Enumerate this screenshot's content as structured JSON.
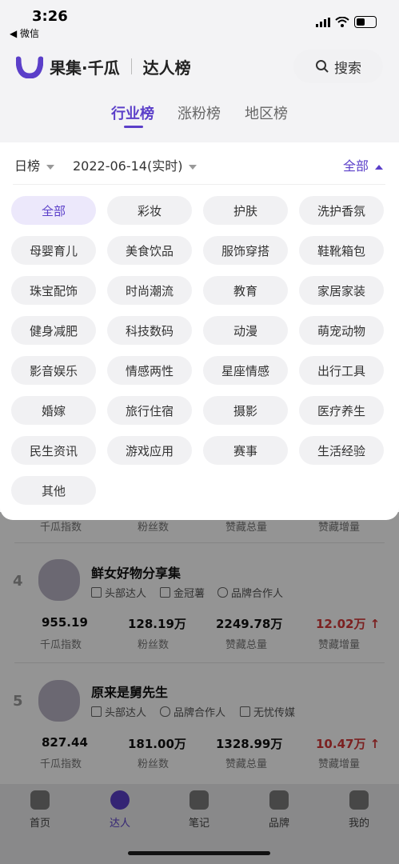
{
  "status_bar": {
    "time": "3:26",
    "back_app": "◀ 微信"
  },
  "header": {
    "brand": "果集·千瓜",
    "title": "达人榜",
    "search_label": "搜索"
  },
  "tabs": [
    {
      "label": "行业榜",
      "active": true
    },
    {
      "label": "涨粉榜",
      "active": false
    },
    {
      "label": "地区榜",
      "active": false
    }
  ],
  "filters": {
    "period": "日榜",
    "date": "2022-06-14(实时)",
    "toggle": "全部"
  },
  "categories": [
    "全部",
    "彩妆",
    "护肤",
    "洗护香氛",
    "母婴育儿",
    "美食饮品",
    "服饰穿搭",
    "鞋靴箱包",
    "珠宝配饰",
    "时尚潮流",
    "教育",
    "家居家装",
    "健身减肥",
    "科技数码",
    "动漫",
    "萌宠动物",
    "影音娱乐",
    "情感两性",
    "星座情感",
    "出行工具",
    "婚嫁",
    "旅行住宿",
    "摄影",
    "医疗养生",
    "民生资讯",
    "游戏应用",
    "赛事",
    "生活经验",
    "其他"
  ],
  "prev_row_labels": [
    "千瓜指数",
    "粉丝数",
    "赞藏总量",
    "赞藏增量"
  ],
  "rows": [
    {
      "rank": "4",
      "name": "鲜女好物分享集",
      "tags": [
        "头部达人",
        "金冠薯",
        "品牌合作人"
      ],
      "stats": [
        {
          "value": "955.19",
          "label": "千瓜指数"
        },
        {
          "value": "128.19万",
          "label": "粉丝数"
        },
        {
          "value": "2249.78万",
          "label": "赞藏总量"
        },
        {
          "value": "12.02万 ↑",
          "label": "赞藏增量"
        }
      ]
    },
    {
      "rank": "5",
      "name": "原来是舅先生",
      "tags": [
        "头部达人",
        "品牌合作人",
        "无忧传媒"
      ],
      "stats": [
        {
          "value": "827.44",
          "label": "千瓜指数"
        },
        {
          "value": "181.00万",
          "label": "粉丝数"
        },
        {
          "value": "1328.99万",
          "label": "赞藏总量"
        },
        {
          "value": "10.47万 ↑",
          "label": "赞藏增量"
        }
      ]
    }
  ],
  "bottom_nav": [
    {
      "label": "首页",
      "active": false
    },
    {
      "label": "达人",
      "active": true
    },
    {
      "label": "笔记",
      "active": false
    },
    {
      "label": "品牌",
      "active": false
    },
    {
      "label": "我的",
      "active": false
    }
  ],
  "colors": {
    "accent": "#5b3fc9",
    "increase": "#d53a3a"
  }
}
